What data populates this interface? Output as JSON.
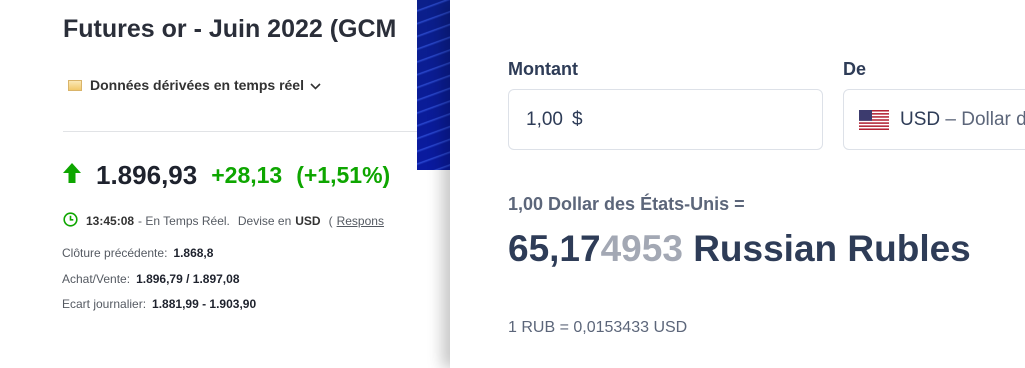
{
  "quote": {
    "title": "Futures or - Juin 2022 (GCM",
    "realtime_label": "Données dérivées en temps réel",
    "last": "1.896,93",
    "change": "+28,13",
    "change_pct": "(+1,51%)",
    "time": "13:45:08",
    "time_suffix": "- En Temps Réel.",
    "currency_prefix": "Devise en",
    "currency": "USD",
    "responsibility_prefix": "(",
    "responsibility": "Respons",
    "stats": [
      {
        "label": "Clôture précédente:",
        "value": "1.868,8"
      },
      {
        "label": "Achat/Vente:",
        "value": "1.896,79 / 1.897,08"
      },
      {
        "label": "Ecart journalier:",
        "value": "1.881,99 - 1.903,90"
      }
    ],
    "colors": {
      "up": "#0ea600"
    }
  },
  "converter": {
    "amount_label": "Montant",
    "amount_value": "1,00",
    "amount_symbol": "$",
    "from_label": "De",
    "from_code": "USD",
    "from_name": "– Dollar d",
    "result_from": "1,00 Dollar des États-Unis =",
    "result_main": "65,17",
    "result_faded": "4953",
    "result_currency": "Russian Rubles",
    "inverse_rate": "1 RUB = 0,0153433 USD"
  }
}
